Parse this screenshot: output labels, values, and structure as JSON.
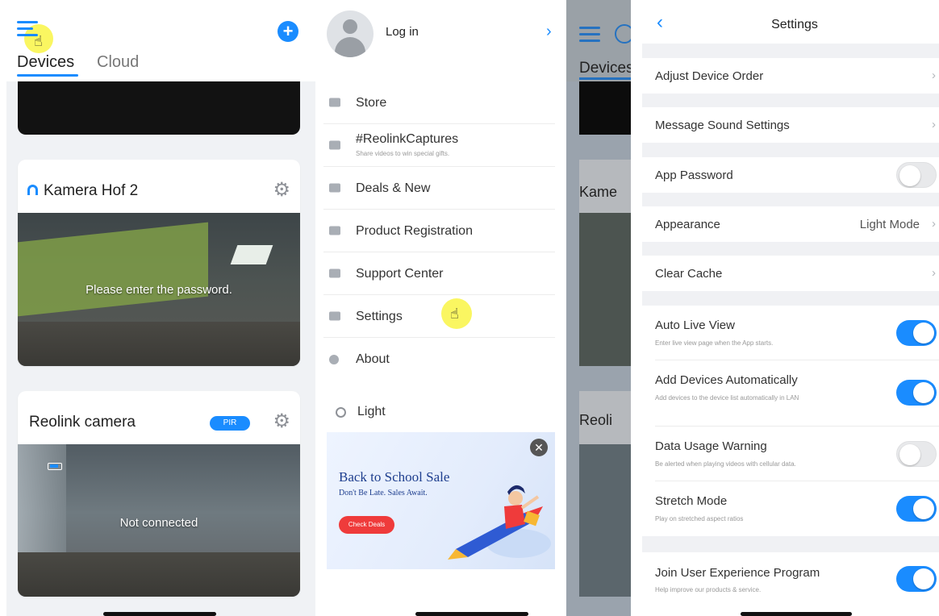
{
  "colors": {
    "accent": "#1a8cff",
    "badge_blue": "#1a8cff",
    "deal_red": "#ef3b3b"
  },
  "devices_screen": {
    "menu_icon": "hamburger-menu-icon",
    "add_icon": "plus-circle-icon",
    "add_symbol": "+",
    "tabs": [
      "Devices",
      "Cloud"
    ],
    "cameras": [
      {
        "name": "Kamera Hof 2",
        "status_icon": "cloud-arc-icon",
        "settings_icon": "gear-icon",
        "video_message": "Please enter the password."
      },
      {
        "name": "Reolink camera",
        "badge": "PIR",
        "settings_icon": "gear-icon",
        "video_message": "Not connected"
      }
    ]
  },
  "drawer": {
    "login": "Log in",
    "items": [
      {
        "label": "Store",
        "icon": "store-icon"
      },
      {
        "label": "#ReolinkCaptures",
        "sub": "Share videos to win special gifts.",
        "icon": "video-icon"
      },
      {
        "label": "Deals & New",
        "icon": "flag-icon"
      },
      {
        "label": "Product Registration",
        "icon": "edit-icon"
      },
      {
        "label": "Support Center",
        "icon": "support-icon"
      },
      {
        "label": "Settings",
        "icon": "gear-icon"
      },
      {
        "label": "About",
        "icon": "info-icon"
      }
    ],
    "theme": "Light",
    "banner": {
      "title": "Back to School Sale",
      "subtitle": "Don't Be Late. Sales Await.",
      "button": "Check Deals",
      "close_symbol": "✕"
    },
    "background": {
      "tab": "Devices",
      "card1": "Kame",
      "card2": "Reoli"
    }
  },
  "settings": {
    "title": "Settings",
    "back_symbol": "‹",
    "chevron": "›",
    "rows": [
      {
        "label": "Adjust Device Order"
      },
      {
        "label": "Message Sound Settings"
      },
      {
        "label": "App Password",
        "toggle": false
      },
      {
        "label": "Appearance",
        "value": "Light Mode"
      },
      {
        "label": "Clear Cache"
      },
      {
        "label": "Auto Live View",
        "sub": "Enter live view page when the App starts.",
        "toggle": true
      },
      {
        "label": "Add Devices Automatically",
        "sub": "Add devices to the device list automatically in LAN",
        "toggle": true
      },
      {
        "label": "Data Usage Warning",
        "sub": "Be alerted when playing videos with cellular data.",
        "toggle": false
      },
      {
        "label": "Stretch Mode",
        "sub": "Play on stretched aspect ratios",
        "toggle": true
      },
      {
        "label": "Join User Experience Program",
        "sub": "Help improve our products & service.",
        "toggle": true
      }
    ]
  }
}
